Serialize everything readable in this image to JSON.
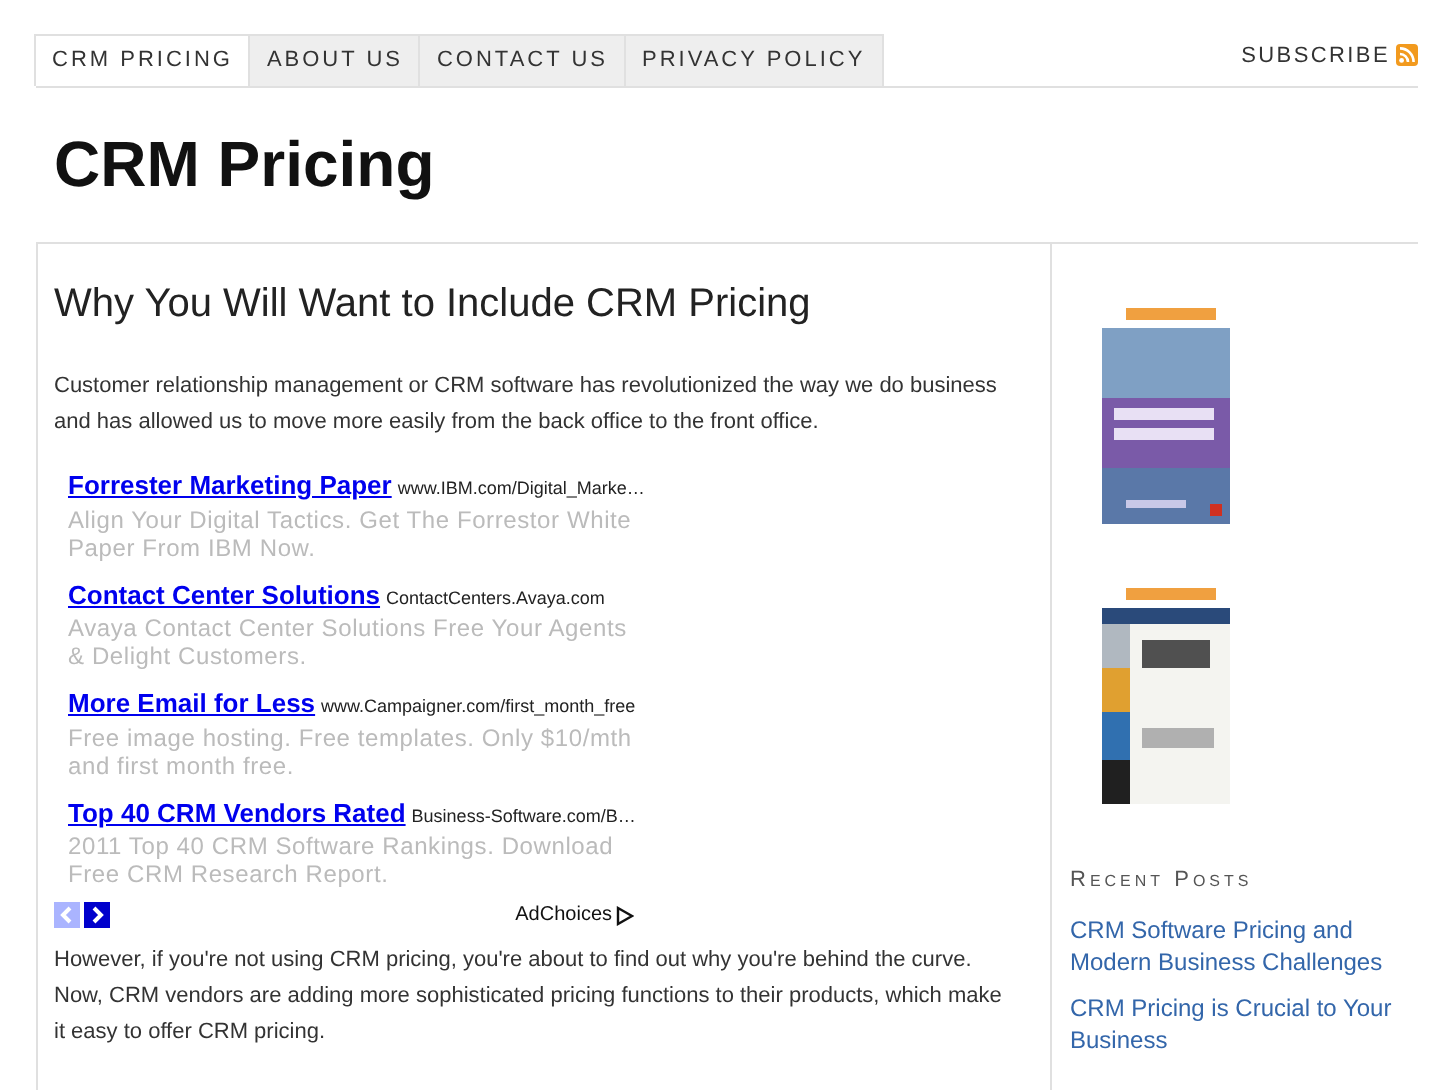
{
  "nav": {
    "tabs": [
      {
        "label": "CRM PRICING",
        "selected": true
      },
      {
        "label": "ABOUT US",
        "selected": false
      },
      {
        "label": "CONTACT US",
        "selected": false
      },
      {
        "label": "PRIVACY POLICY",
        "selected": false
      }
    ],
    "subscribe": "SUBSCRIBE"
  },
  "site_title": "CRM Pricing",
  "article": {
    "title": "Why You Will Want to Include CRM Pricing",
    "intro": "Customer relationship management or CRM software has revolutionized the way we do business and has allowed us to move more easily from the back office to the front office.",
    "ads": [
      {
        "title": "Forrester Marketing Paper",
        "url": "www.IBM.com/Digital_Marke…",
        "text": "Align Your Digital Tactics. Get The Forrestor White Paper From IBM Now."
      },
      {
        "title": "Contact Center Solutions",
        "url": "ContactCenters.Avaya.com",
        "text": "Avaya Contact Center Solutions Free Your Agents & Delight Customers."
      },
      {
        "title": "More Email for Less",
        "url": "www.Campaigner.com/first_month_free",
        "text": "Free image hosting. Free templates. Only $10/mth and first month free."
      },
      {
        "title": "Top 40 CRM Vendors Rated",
        "url": "Business-Software.com/B…",
        "text": "2011 Top 40 CRM Software Rankings. Download Free CRM Research Report."
      }
    ],
    "ad_prev_disabled": true,
    "ad_next_disabled": false,
    "adchoices": "AdChoices",
    "body": "However, if you're not using CRM pricing, you're about to find out why you're behind the curve. Now, CRM vendors are adding more sophisticated pricing functions to their products, which make it easy to offer CRM pricing."
  },
  "sidebar": {
    "recent_posts": {
      "heading": "Recent Posts",
      "items": [
        "CRM Software Pricing and Modern Business Challenges",
        "CRM Pricing is Crucial to Your Business"
      ]
    }
  }
}
